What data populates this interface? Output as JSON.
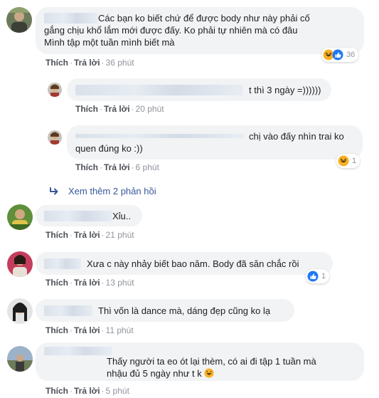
{
  "actions": {
    "like": "Thích",
    "reply": "Trả lời",
    "separator": "·"
  },
  "comments": [
    {
      "text_line1": "Các bạn ko biết chứ để được body như này phải cố",
      "text_line2": "gắng chịu khổ lắm mới được đấy. Ko phải tự nhiên mà có đâu",
      "text_line3": "Mình tập một tuần mình biết mà",
      "time": "36 phút",
      "reaction_icons": [
        "haha-icon",
        "like-icon"
      ],
      "reaction_count": "36"
    },
    {
      "text": "t thì 3 ngày =))))))",
      "time": "20 phút"
    },
    {
      "text_line1": "chị vào đấy nhìn trai ko",
      "text_line2": "quen đúng ko :))",
      "time": "6 phút",
      "reaction_icons": [
        "haha-icon"
      ],
      "reaction_count": "1"
    },
    {
      "text": "Xỉu..",
      "time": "21 phút"
    },
    {
      "text": "Xưa c này nhảy biết bao năm. Body đã săn chắc rồi",
      "time": "13 phút",
      "reaction_icons": [
        "like-icon"
      ],
      "reaction_count": "1"
    },
    {
      "text": "Thì vốn là dance mà, dáng đẹp cũng ko lạ",
      "time": "11 phút"
    },
    {
      "text_line1": "Thấy người ta eo ót lại thèm, có ai đi tập 1 tuần mà",
      "text_line2": "nhậu đủ 5 ngày như t k",
      "time": "5 phút"
    }
  ],
  "more_replies": "Xem thêm 2 phản hồi",
  "colors": {
    "bubble": "#f2f3f5",
    "link": "#385898",
    "action": "#4b4f56",
    "meta": "#90949c",
    "like_blue": "#2078f4",
    "haha_yellow": "#f7b125"
  }
}
